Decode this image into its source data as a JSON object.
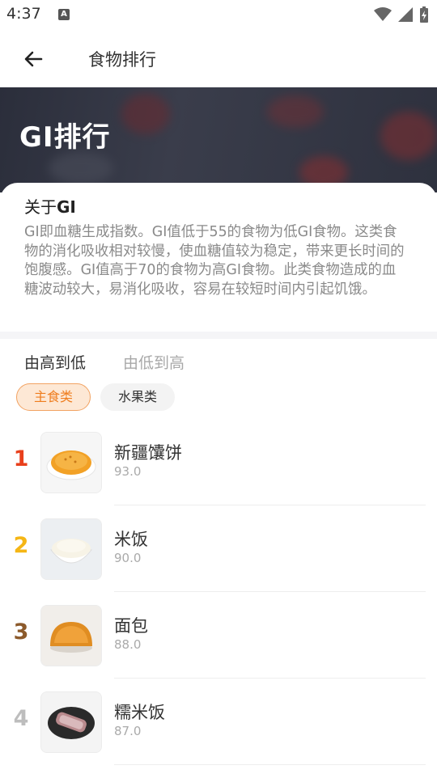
{
  "status_bar": {
    "time": "4:37",
    "badge": "A"
  },
  "appbar": {
    "title": "食物排行"
  },
  "hero": {
    "title": "GI排行"
  },
  "about": {
    "title_prefix": "关于",
    "title_strong": "GI",
    "body": "GI即血糖生成指数。GI值低于55的食物为低GI食物。这类食物的消化吸收相对较慢，使血糖值较为稳定，带来更长时间的饱腹感。GI值高于70的食物为高GI食物。此类食物造成的血糖波动较大，易消化吸收，容易在较短时间内引起饥饿。"
  },
  "sort": {
    "active": "由高到低",
    "inactive": "由低到高"
  },
  "categories": {
    "active": "主食类",
    "inactive": "水果类"
  },
  "colors": {
    "rank1": "#e8401c",
    "rank2": "#f5b615",
    "rank3": "#8c5a2b",
    "rank4": "#bdbdbd",
    "accent": "#ef7d1e"
  },
  "items": [
    {
      "rank": "1",
      "name": "新疆馕饼",
      "value": "93.0",
      "thumb_icon": "naan-bread-image"
    },
    {
      "rank": "2",
      "name": "米饭",
      "value": "90.0",
      "thumb_icon": "rice-bowl-image"
    },
    {
      "rank": "3",
      "name": "面包",
      "value": "88.0",
      "thumb_icon": "bread-bun-image"
    },
    {
      "rank": "4",
      "name": "糯米饭",
      "value": "87.0",
      "thumb_icon": "sticky-rice-image"
    }
  ]
}
